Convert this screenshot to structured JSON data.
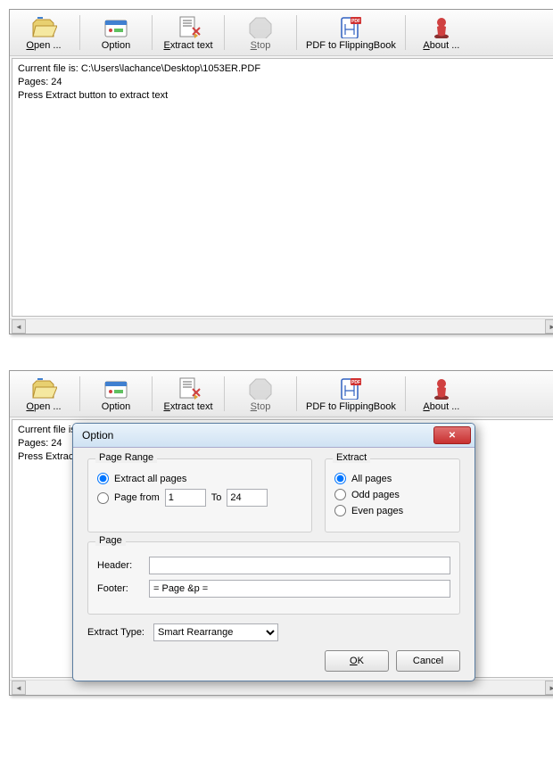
{
  "toolbar": {
    "open": "Open ...",
    "option": "Option",
    "extract": "Extract text",
    "stop": "Stop",
    "pdf2fb": "PDF to FlippingBook",
    "about": "About ..."
  },
  "status": {
    "line1": "Current file is: C:\\Users\\lachance\\Desktop\\1053ER.PDF",
    "line2": "Pages: 24",
    "line3": "Press Extract button to extract text",
    "line1b": "Current file is: C",
    "line3b": "Press Extract b"
  },
  "dialog": {
    "title": "Option",
    "pageRange": {
      "title": "Page Range",
      "opt1": "Extract all pages",
      "opt2": "Page from",
      "from": "1",
      "toLabel": "To",
      "to": "24"
    },
    "extract": {
      "title": "Extract",
      "opt1": "All pages",
      "opt2": "Odd pages",
      "opt3": "Even pages"
    },
    "page": {
      "title": "Page",
      "headerLabel": "Header:",
      "headerVal": "",
      "footerLabel": "Footer:",
      "footerVal": "= Page &p ="
    },
    "extractTypeLabel": "Extract Type:",
    "extractTypeOptions": [
      "Smart Rearrange"
    ],
    "ok": "OK",
    "cancel": "Cancel"
  }
}
